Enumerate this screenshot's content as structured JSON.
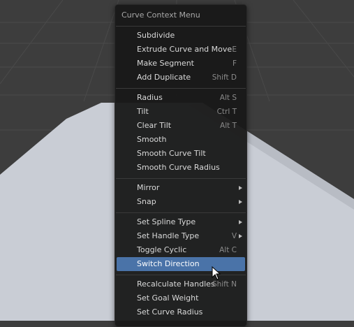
{
  "menu": {
    "title": "Curve Context Menu",
    "items": [
      {
        "label": "Subdivide",
        "shortcut": ""
      },
      {
        "label": "Extrude Curve and Move",
        "shortcut": "E"
      },
      {
        "label": "Make Segment",
        "shortcut": "F"
      },
      {
        "label": "Add Duplicate",
        "shortcut": "Shift D"
      },
      {
        "label": "Radius",
        "shortcut": "Alt S"
      },
      {
        "label": "Tilt",
        "shortcut": "Ctrl T"
      },
      {
        "label": "Clear Tilt",
        "shortcut": "Alt T"
      },
      {
        "label": "Smooth",
        "shortcut": ""
      },
      {
        "label": "Smooth Curve Tilt",
        "shortcut": ""
      },
      {
        "label": "Smooth Curve Radius",
        "shortcut": ""
      },
      {
        "label": "Mirror",
        "shortcut": ""
      },
      {
        "label": "Snap",
        "shortcut": ""
      },
      {
        "label": "Set Spline Type",
        "shortcut": ""
      },
      {
        "label": "Set Handle Type",
        "shortcut": "V"
      },
      {
        "label": "Toggle Cyclic",
        "shortcut": "Alt C"
      },
      {
        "label": "Switch Direction",
        "shortcut": ""
      },
      {
        "label": "Recalculate Handles",
        "shortcut": "Shift N"
      },
      {
        "label": "Set Goal Weight",
        "shortcut": ""
      },
      {
        "label": "Set Curve Radius",
        "shortcut": ""
      }
    ]
  },
  "colors": {
    "viewport_bg": "#3d3d3d",
    "curve_surface": "#c9cdd5",
    "menu_bg": "#181818",
    "highlight": "#4a73a8",
    "text": "#d9d9d9",
    "shortcut_text": "#8a8a8a"
  },
  "icons": {
    "cursor": "mouse-pointer-icon",
    "submenu": "chevron-right-icon"
  }
}
